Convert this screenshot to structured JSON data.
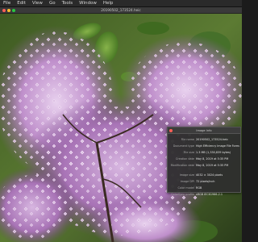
{
  "menubar": {
    "items": [
      "File",
      "Edit",
      "View",
      "Go",
      "Tools",
      "Window",
      "Help"
    ]
  },
  "window": {
    "title": "20190502_173524.heic"
  },
  "info_panel": {
    "title": "Image Info",
    "rows": [
      {
        "label": "File name",
        "value": "20190502_173524.heic"
      },
      {
        "label": "Document type",
        "value": "High Efficiency Image File Format"
      },
      {
        "label": "File size",
        "value": "1.3 MB (1,330,839 bytes)"
      },
      {
        "label": "Creation date",
        "value": "May 8, 2019 at 5:35 PM"
      },
      {
        "label": "Modification date",
        "value": "May 8, 2019 at 5:35 PM"
      },
      {
        "label": "Image size",
        "value": "4032 × 3024 pixels"
      },
      {
        "label": "Image DPI",
        "value": "72 pixels/inch"
      },
      {
        "label": "Color model",
        "value": "RGB"
      },
      {
        "label": "ColorSync profile",
        "value": "sRGB IEC61966-2.1"
      }
    ]
  },
  "colors": {
    "lilac": "#b98ac4",
    "leaf": "#4f7a2c",
    "panel": "#2e2e2e"
  }
}
